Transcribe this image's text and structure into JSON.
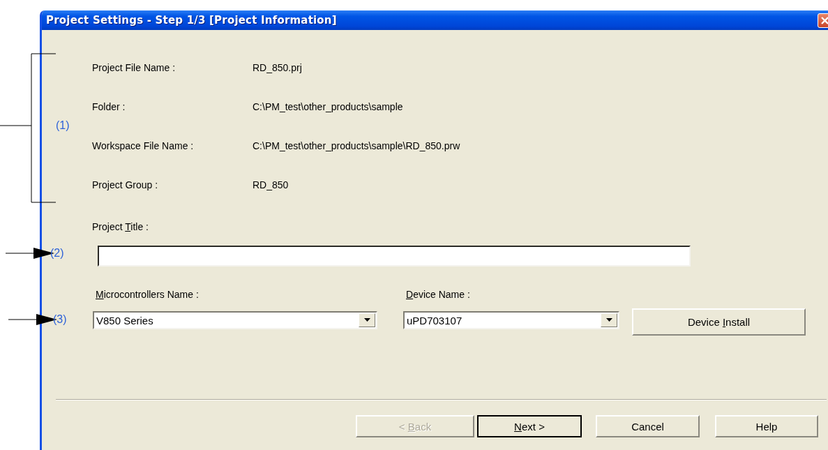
{
  "window": {
    "title": "Project Settings - Step 1/3 [Project Information]"
  },
  "info_rows": [
    {
      "label": "Project File Name :",
      "value": "RD_850.prj"
    },
    {
      "label": "Folder :",
      "value": "C:\\PM_test\\other_products\\sample"
    },
    {
      "label": "Workspace File Name :",
      "value": "C:\\PM_test\\other_products\\sample\\RD_850.prw"
    },
    {
      "label": "Project Group :",
      "value": "RD_850"
    }
  ],
  "project_title": {
    "label_parts": [
      {
        "text": "Project ",
        "underlined": false
      },
      {
        "text": "T",
        "underlined": true
      },
      {
        "text": "itle :",
        "underlined": false
      }
    ]
  },
  "microcontrollers": {
    "label_parts": [
      {
        "text": "M",
        "underlined": true
      },
      {
        "text": "icrocontrollers Name :",
        "underlined": false
      }
    ],
    "value": "V850 Series"
  },
  "device": {
    "label_parts": [
      {
        "text": "D",
        "underlined": true
      },
      {
        "text": "evice Name :",
        "underlined": false
      }
    ],
    "value": "uPD703107"
  },
  "device_install": {
    "label_parts": [
      {
        "text": "Device ",
        "underlined": false
      },
      {
        "text": "I",
        "underlined": true
      },
      {
        "text": "nstall",
        "underlined": false
      }
    ]
  },
  "buttons": [
    {
      "label_parts": [
        {
          "text": "< ",
          "underlined": false
        },
        {
          "text": "B",
          "underlined": true
        },
        {
          "text": "ack",
          "underlined": false
        }
      ],
      "disabled": true,
      "default": false
    },
    {
      "label_parts": [
        {
          "text": "N",
          "underlined": true
        },
        {
          "text": "ext >",
          "underlined": false
        }
      ],
      "disabled": false,
      "default": true
    },
    {
      "label_parts": [
        {
          "text": "Cancel",
          "underlined": false
        }
      ],
      "disabled": false,
      "default": false
    },
    {
      "label_parts": [
        {
          "text": "Help",
          "underlined": false
        }
      ],
      "disabled": false,
      "default": false
    }
  ],
  "annotations": [
    {
      "label": "(1)",
      "kind": "bracket"
    },
    {
      "label": "(2)",
      "kind": "arrow"
    },
    {
      "label": "(3)",
      "kind": "arrow"
    }
  ]
}
